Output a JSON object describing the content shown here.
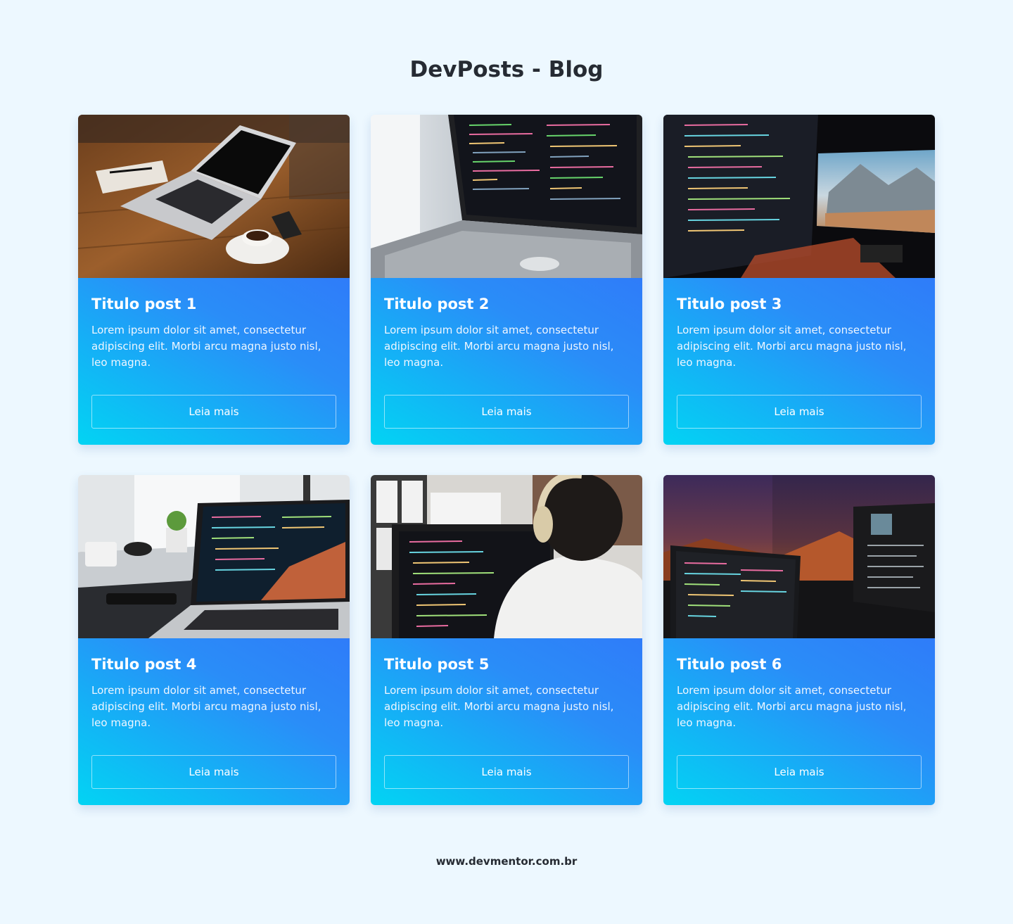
{
  "header": {
    "title": "DevPosts - Blog"
  },
  "posts": [
    {
      "image": "laptop-on-wooden-desk-with-coffee",
      "title": "Titulo post 1",
      "text": "Lorem ipsum dolor sit amet, consectetur adipiscing elit. Morbi arcu magna justo nisl, leo magna.",
      "button_label": "Leia mais"
    },
    {
      "image": "laptop-with-code-editor",
      "title": "Titulo post 2",
      "text": "Lorem ipsum dolor sit amet, consectetur adipiscing elit. Morbi arcu magna justo nisl, leo magna.",
      "button_label": "Leia mais"
    },
    {
      "image": "dual-monitors-with-code-and-landscape",
      "title": "Titulo post 3",
      "text": "Lorem ipsum dolor sit amet, consectetur adipiscing elit. Morbi arcu magna justo nisl, leo magna.",
      "button_label": "Leia mais"
    },
    {
      "image": "laptop-with-code-on-office-desk",
      "title": "Titulo post 4",
      "text": "Lorem ipsum dolor sit amet, consectetur adipiscing elit. Morbi arcu magna justo nisl, leo magna.",
      "button_label": "Leia mais"
    },
    {
      "image": "developer-with-headphones-at-monitor",
      "title": "Titulo post 5",
      "text": "Lorem ipsum dolor sit amet, consectetur adipiscing elit. Morbi arcu magna justo nisl, leo magna.",
      "button_label": "Leia mais"
    },
    {
      "image": "dark-desk-with-monitors-at-night",
      "title": "Titulo post 6",
      "text": "Lorem ipsum dolor sit amet, consectetur adipiscing elit. Morbi arcu magna justo nisl, leo magna.",
      "button_label": "Leia mais"
    }
  ],
  "footer": {
    "text": "www.devmentor.com.br"
  },
  "colors": {
    "background": "#edf8ff",
    "gradient_start": "#02d4f3",
    "gradient_end": "#2f7cf9",
    "title_text": "#262b33"
  }
}
